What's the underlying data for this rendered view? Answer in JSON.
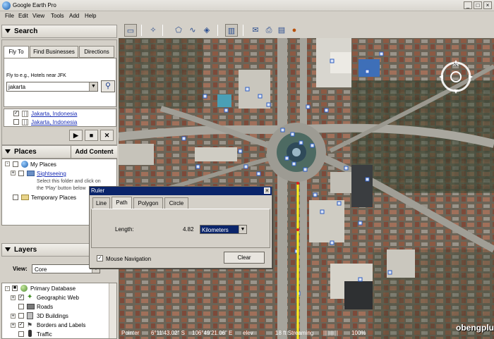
{
  "window": {
    "title": "Google Earth Pro"
  },
  "menu": [
    "File",
    "Edit",
    "View",
    "Tools",
    "Add",
    "Help"
  ],
  "toolbar": {
    "icons": [
      "sidebar-toggle-icon",
      "placemark-icon",
      "polygon-icon",
      "path-icon",
      "overlay-icon",
      "ruler-icon",
      "email-icon",
      "print-icon",
      "maps-icon",
      "earth-icon"
    ]
  },
  "search": {
    "heading": "Search",
    "tabs": [
      "Fly To",
      "Find Businesses",
      "Directions"
    ],
    "hint": "Fly to e.g., Hotels near JFK",
    "query": "jakarta",
    "results": [
      "Jakarta, Indonesia",
      "Jakarta, Indonesia"
    ]
  },
  "places": {
    "heading": "Places",
    "add_content": "Add Content",
    "my_places": "My Places",
    "sightseeing": "Sightseeing",
    "note_line1": "Select this folder and click on",
    "note_line2": "the 'Play' button below",
    "temporary": "Temporary Places"
  },
  "layers": {
    "heading": "Layers",
    "view_label": "View:",
    "view_value": "Core",
    "items": [
      "Primary Database",
      "Geographic Web",
      "Roads",
      "3D Buildings",
      "Borders and Labels",
      "Traffic"
    ]
  },
  "ruler": {
    "title": "Ruler",
    "tabs": [
      "Line",
      "Path",
      "Polygon",
      "Circle"
    ],
    "active_tab": "Path",
    "length_label": "Length:",
    "length_value": "4.82",
    "unit": "Kilometers",
    "mouse_nav": "Mouse Navigation",
    "clear": "Clear"
  },
  "status": {
    "pointer_label": "Pointer",
    "lat": "6°11'43.02\" S",
    "lon": "106°49'21.06\" E",
    "elev_label": "elev",
    "stream_label": "18 ft Streaming",
    "stream_bar": "||||||||||",
    "stream_pct": "100%"
  },
  "watermark": "obengplus.com"
}
